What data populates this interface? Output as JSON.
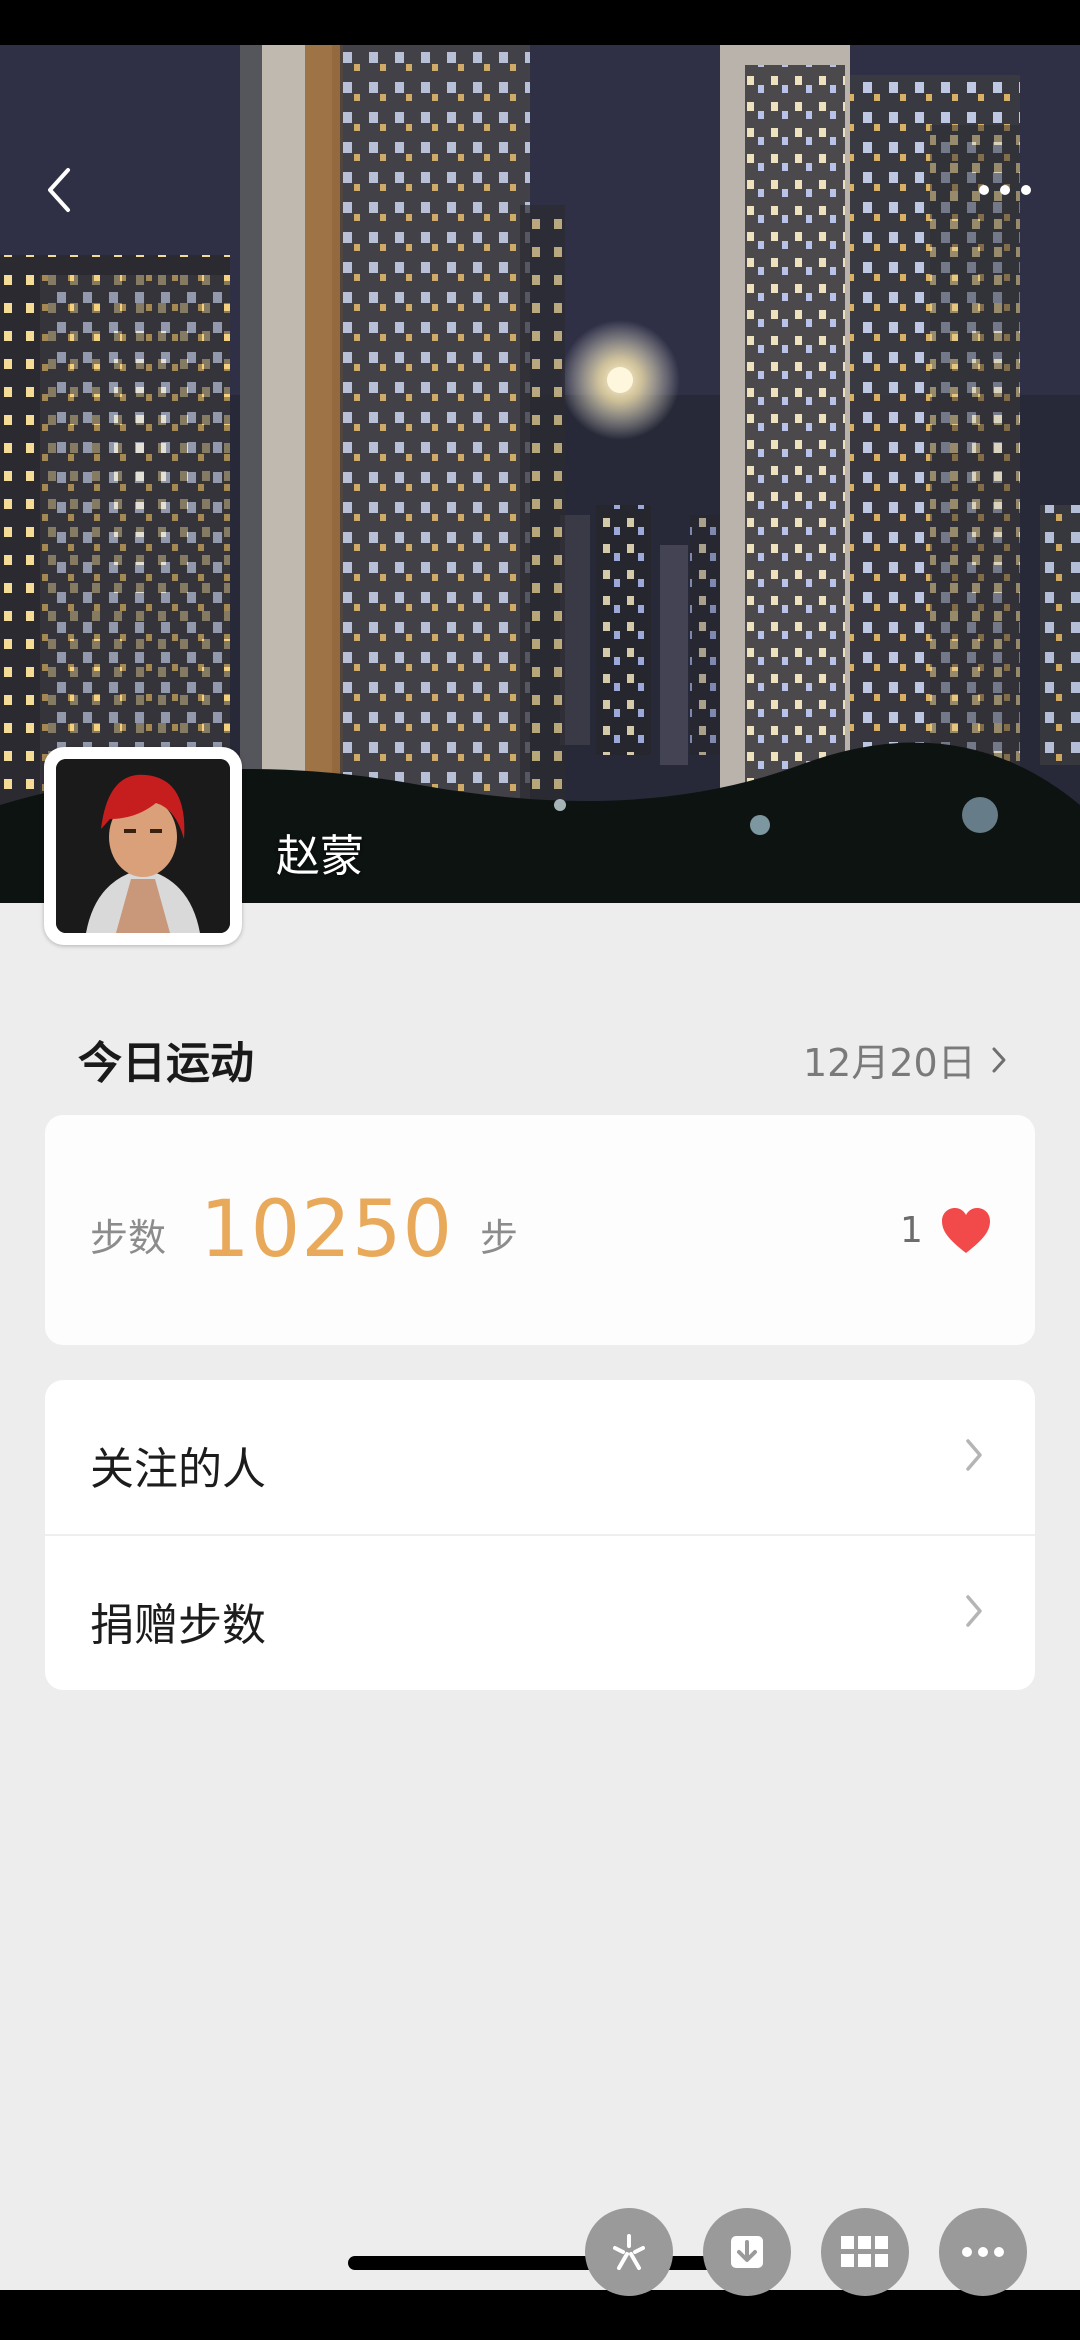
{
  "profile": {
    "name": "赵蒙"
  },
  "today": {
    "title": "今日运动",
    "date": "12月20日"
  },
  "steps": {
    "label": "步数",
    "value": "10250",
    "unit": "步",
    "likes": "1"
  },
  "menu": {
    "items": [
      {
        "label": "关注的人"
      },
      {
        "label": "捐赠步数"
      }
    ]
  },
  "colors": {
    "accent": "#e9a95b",
    "heart": "#f24a4a",
    "background": "#ededed"
  },
  "icons": [
    "back-icon",
    "more-icon",
    "heart-icon",
    "chevron-right-icon",
    "sparkle-icon",
    "download-icon",
    "grid-icon",
    "ellipsis-icon"
  ]
}
